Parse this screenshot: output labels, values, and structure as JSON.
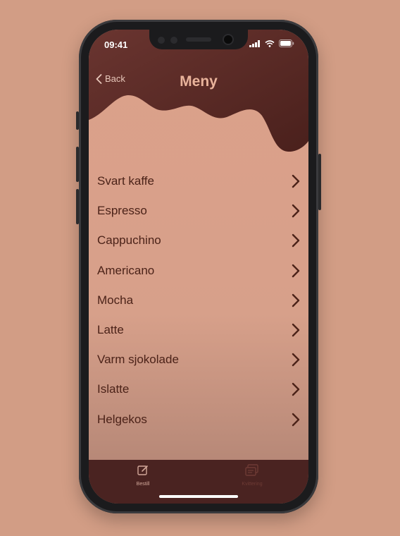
{
  "status_bar": {
    "time": "09:41"
  },
  "nav": {
    "back_label": "Back",
    "title": "Meny"
  },
  "menu": {
    "items": [
      {
        "label": "Svart kaffe"
      },
      {
        "label": "Espresso"
      },
      {
        "label": "Cappuchino"
      },
      {
        "label": "Americano"
      },
      {
        "label": "Mocha"
      },
      {
        "label": "Latte"
      },
      {
        "label": "Varm sjokolade"
      },
      {
        "label": "Islatte"
      },
      {
        "label": "Helgekos"
      }
    ]
  },
  "tabbar": {
    "tabs": [
      {
        "label": "Bestill",
        "icon": "compose-icon",
        "active": true
      },
      {
        "label": "Kvittering",
        "icon": "receipt-icon",
        "active": false
      }
    ]
  },
  "colors": {
    "page_background": "#d29d85",
    "header_brown": "#5a2a26",
    "text_dark": "#4b2218",
    "title": "#e9b39b"
  }
}
